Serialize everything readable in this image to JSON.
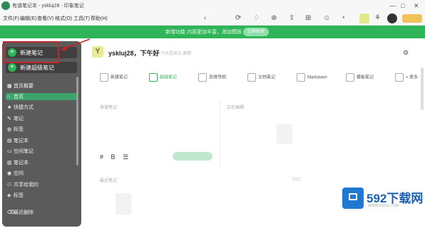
{
  "window": {
    "title": "有道笔记本 - yskluj28 - 印象笔记"
  },
  "menu": [
    "文件(F)",
    "编辑(E)",
    "查看(V)",
    "格式(O)",
    "工具(T)",
    "帮助(H)"
  ],
  "banner": {
    "text": "新增功能  内容更加丰富，添加模板",
    "button_label": "立即体验"
  },
  "sidebar": {
    "new_note": "新建笔记",
    "new_super_note": "新建超级笔记",
    "items": [
      "首页概要",
      "首页",
      "快捷方式",
      "笔记",
      "标签",
      "笔记本",
      "空间笔记",
      "笔记本",
      "空间",
      "共享给我的",
      "标签",
      "",
      "最近删除"
    ]
  },
  "greeting": {
    "avatar_letter": "Y",
    "text": "yskluj28，下午好",
    "sub": "今天是周日 静默"
  },
  "quick_actions": [
    "新建笔记",
    "超级笔记",
    "思维导图",
    "文档笔记",
    "Markdown",
    "模板笔记",
    "+ 更多"
  ],
  "panels": {
    "left_title": "快速笔记",
    "right_title": "正在编辑",
    "recent_title": "最近笔记"
  },
  "format_bar": {
    "hash": "#",
    "bold": "B",
    "list": "☰"
  },
  "watermark": {
    "text": "592下载网",
    "url": "WWW.592XZ.COM"
  }
}
